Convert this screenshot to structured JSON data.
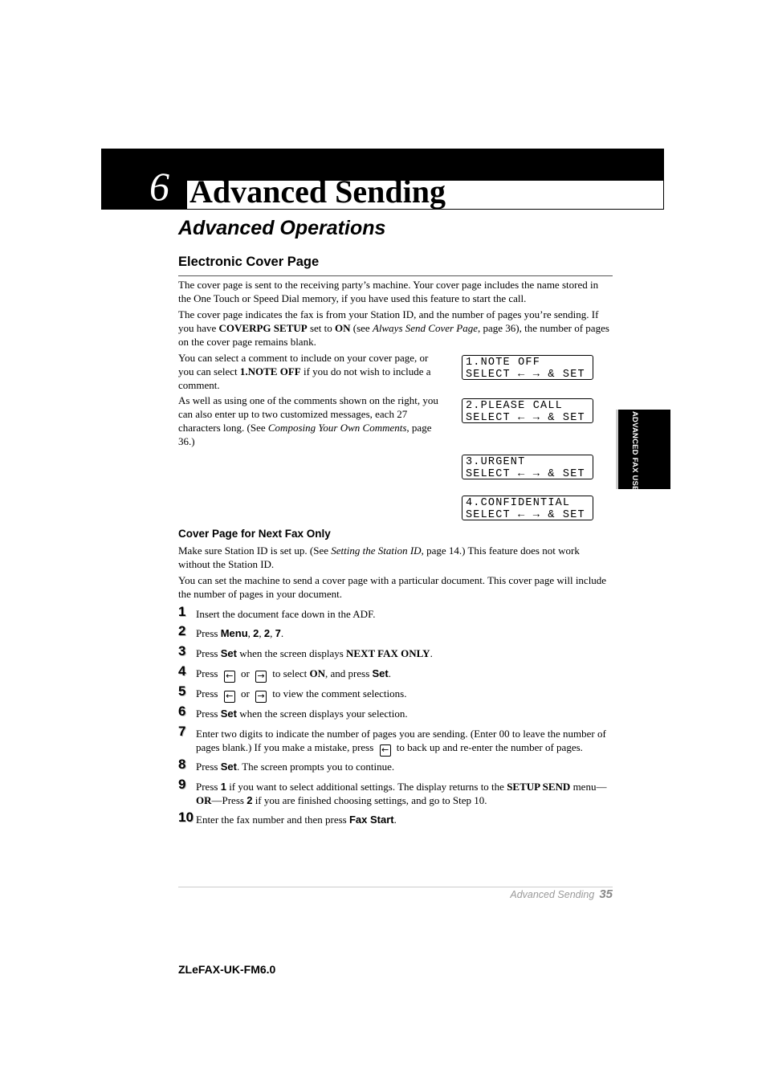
{
  "chapter": {
    "number": "6",
    "title": "Advanced Sending"
  },
  "section_title": "Advanced Operations",
  "subsection_title": "Electronic Cover Page",
  "paragraphs": [
    [
      {
        "t": "The cover page is sent to the receiving party’s machine. Your cover page includes the name stored in the One Touch or Speed Dial memory, if you have used this feature to start the call."
      }
    ],
    [
      {
        "t": "The cover page indicates the fax is from your Station ID, and the number of pages you’re sending. If you have "
      },
      {
        "t": "COVERPG SETUP",
        "s": "b"
      },
      {
        "t": " set to "
      },
      {
        "t": "ON",
        "s": "b"
      },
      {
        "t": " (see "
      },
      {
        "t": "Always Send Cover Page",
        "s": "i"
      },
      {
        "t": ", page 36), the number of pages on the cover page remains blank."
      }
    ],
    [
      {
        "t": "You can select a comment to include on your cover page, or you can select "
      },
      {
        "t": "1.NOTE OFF",
        "s": "b"
      },
      {
        "t": " if you do not wish to include a comment."
      }
    ],
    [
      {
        "t": "As well as using one of the comments shown on the right, you can also enter up to two customized messages, each 27 characters long. (See "
      },
      {
        "t": "Composing Your Own Comments",
        "s": "i"
      },
      {
        "t": ", page 36.)"
      }
    ]
  ],
  "lcd_screens": [
    {
      "line1": "1.NOTE OFF",
      "line2": "SELECT ← → & SET"
    },
    {
      "line1": "2.PLEASE CALL",
      "line2": "SELECT ← → & SET"
    },
    {
      "line1": "3.URGENT",
      "line2": "SELECT ← → & SET"
    },
    {
      "line1": "4.CONFIDENTIAL",
      "line2": "SELECT ← → & SET"
    }
  ],
  "subsubsection_title": "Cover Page for Next Fax Only",
  "paragraphs2": [
    [
      {
        "t": "Make sure Station ID is set up. (See "
      },
      {
        "t": "Setting the Station ID",
        "s": "i"
      },
      {
        "t": ", page 14.) This feature does not work without the Station ID."
      }
    ],
    [
      {
        "t": "You can set the machine to send a cover page with a particular document. This cover page will include the number of pages in your document."
      }
    ]
  ],
  "steps": [
    {
      "n": "1",
      "segs": [
        {
          "t": "Insert the document face down in the ADF."
        }
      ]
    },
    {
      "n": "2",
      "segs": [
        {
          "t": "Press "
        },
        {
          "t": "Menu",
          "s": "bs"
        },
        {
          "t": ", "
        },
        {
          "t": "2",
          "s": "bs"
        },
        {
          "t": ", "
        },
        {
          "t": "2",
          "s": "bs"
        },
        {
          "t": ", "
        },
        {
          "t": "7",
          "s": "bs"
        },
        {
          "t": "."
        }
      ]
    },
    {
      "n": "3",
      "segs": [
        {
          "t": "Press "
        },
        {
          "t": "Set",
          "s": "bs"
        },
        {
          "t": " when the screen displays "
        },
        {
          "t": "NEXT FAX ONLY",
          "s": "b"
        },
        {
          "t": "."
        }
      ]
    },
    {
      "n": "4",
      "segs": [
        {
          "t": "Press "
        },
        {
          "k": "left-arrow-key-icon",
          "g": "←"
        },
        {
          "t": " or "
        },
        {
          "k": "right-arrow-key-icon",
          "g": "→"
        },
        {
          "t": " to select "
        },
        {
          "t": "ON",
          "s": "b"
        },
        {
          "t": ", and press "
        },
        {
          "t": "Set",
          "s": "bs"
        },
        {
          "t": "."
        }
      ]
    },
    {
      "n": "5",
      "segs": [
        {
          "t": "Press "
        },
        {
          "k": "left-arrow-key-icon",
          "g": "←"
        },
        {
          "t": " or "
        },
        {
          "k": "right-arrow-key-icon",
          "g": "→"
        },
        {
          "t": " to view the comment selections."
        }
      ]
    },
    {
      "n": "6",
      "segs": [
        {
          "t": "Press "
        },
        {
          "t": "Set",
          "s": "bs"
        },
        {
          "t": " when the screen displays your selection."
        }
      ]
    },
    {
      "n": "7",
      "segs": [
        {
          "t": "Enter two digits to indicate the number of pages you are sending. (Enter 00 to leave the number of pages blank.) If you make a mistake, press "
        },
        {
          "k": "left-arrow-key-icon",
          "g": "←"
        },
        {
          "t": " to back up and re-enter the number of pages."
        }
      ]
    },
    {
      "n": "8",
      "segs": [
        {
          "t": "Press "
        },
        {
          "t": "Set",
          "s": "bs"
        },
        {
          "t": ". The screen prompts you to continue."
        }
      ]
    },
    {
      "n": "9",
      "segs": [
        {
          "t": "Press "
        },
        {
          "t": "1",
          "s": "bs"
        },
        {
          "t": " if you want to select additional settings. The display returns to the "
        },
        {
          "t": "SETUP SEND",
          "s": "b"
        },
        {
          "t": " menu—"
        },
        {
          "t": "OR",
          "s": "b"
        },
        {
          "t": "—Press "
        },
        {
          "t": "2",
          "s": "bs"
        },
        {
          "t": " if you are finished choosing settings, and go to Step 10."
        }
      ]
    },
    {
      "n": "10",
      "segs": [
        {
          "t": "Enter the fax number and then press "
        },
        {
          "t": "Fax Start",
          "s": "bs"
        },
        {
          "t": "."
        }
      ]
    }
  ],
  "side_tab": "ADVANCED FAX USE",
  "footer": {
    "section": "Advanced Sending",
    "page": "35"
  },
  "doc_code": "ZLeFAX-UK-FM6.0"
}
